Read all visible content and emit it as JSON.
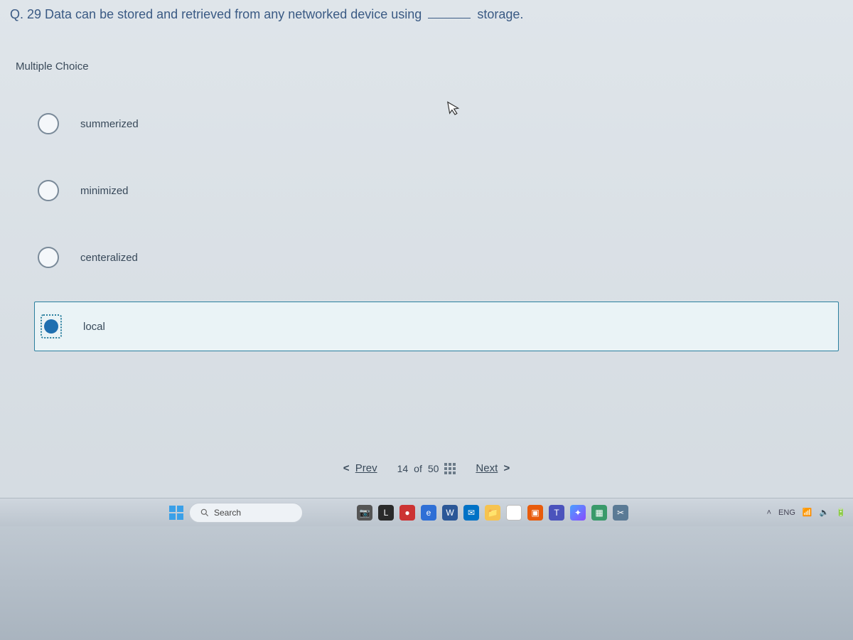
{
  "question": {
    "prefix": "Q. 29 Data can be stored and retrieved from any networked device using",
    "suffix": "storage."
  },
  "section_label": "Multiple Choice",
  "options": [
    {
      "label": "summerized",
      "selected": false
    },
    {
      "label": "minimized",
      "selected": false
    },
    {
      "label": "centeralized",
      "selected": false
    },
    {
      "label": "local",
      "selected": true
    }
  ],
  "nav": {
    "prev_caret": "<",
    "prev": "Prev",
    "progress_current": "14",
    "progress_sep": "of",
    "progress_total": "50",
    "next": "Next",
    "next_caret": ">"
  },
  "taskbar": {
    "search_placeholder": "Search",
    "lang": "ENG"
  }
}
